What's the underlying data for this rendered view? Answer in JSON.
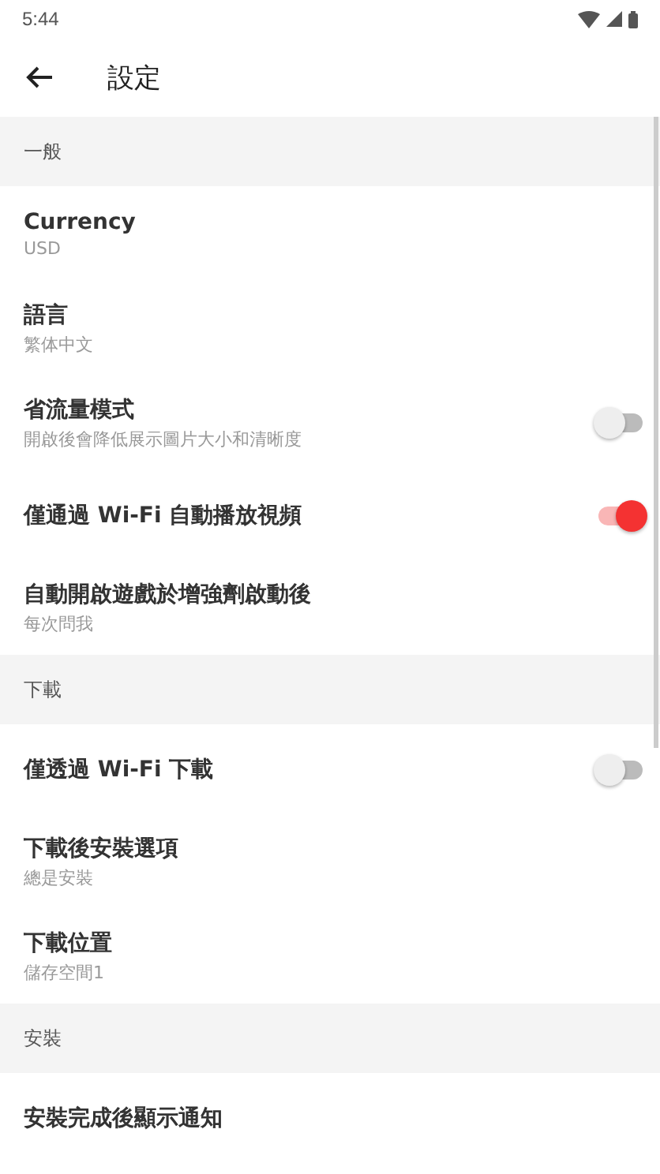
{
  "status_bar": {
    "time": "5:44"
  },
  "app_bar": {
    "title": "設定"
  },
  "sections": [
    {
      "header": "一般",
      "items": [
        {
          "kind": "nav",
          "title": "Currency",
          "subtitle": "USD"
        },
        {
          "kind": "nav",
          "title": "語言",
          "subtitle": "繁体中文"
        },
        {
          "kind": "toggle",
          "title": "省流量模式",
          "subtitle": "開啟後會降低展示圖片大小和清晰度",
          "on": false
        },
        {
          "kind": "toggle",
          "title": "僅通過 Wi-Fi 自動播放視頻",
          "on": true
        },
        {
          "kind": "nav",
          "title": "自動開啟遊戲於增強劑啟動後",
          "subtitle": "每次問我"
        }
      ]
    },
    {
      "header": "下載",
      "items": [
        {
          "kind": "toggle",
          "title": "僅透過 Wi-Fi 下載",
          "on": false
        },
        {
          "kind": "nav",
          "title": "下載後安裝選項",
          "subtitle": "總是安裝"
        },
        {
          "kind": "nav",
          "title": "下載位置",
          "subtitle": "儲存空間1"
        }
      ]
    },
    {
      "header": "安裝",
      "items": [
        {
          "kind": "nav",
          "title": "安裝完成後顯示通知"
        }
      ]
    }
  ]
}
